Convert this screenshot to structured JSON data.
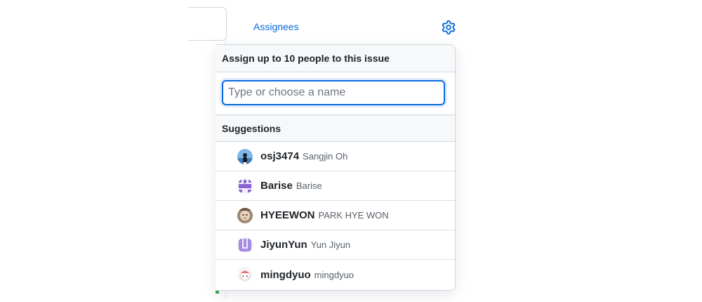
{
  "sidebar": {
    "assignees_heading": "Assignees",
    "settings_icon": "gear-icon",
    "accent_color": "#0969da"
  },
  "popover": {
    "header": "Assign up to 10 people to this issue",
    "filter": {
      "value": "",
      "placeholder": "Type or choose a name"
    },
    "suggestions_heading": "Suggestions",
    "suggestions": [
      {
        "login": "osj3474",
        "name": "Sangjin Oh",
        "avatar": "photo-avatar"
      },
      {
        "login": "Barise",
        "name": "Barise",
        "avatar": "identicon-avatar"
      },
      {
        "login": "HYEEWON",
        "name": "PARK HYE WON",
        "avatar": "photo-avatar"
      },
      {
        "login": "JiyunYun",
        "name": "Yun Jiyun",
        "avatar": "identicon-avatar"
      },
      {
        "login": "mingdyuo",
        "name": "mingdyuo",
        "avatar": "illustration-avatar"
      }
    ]
  }
}
